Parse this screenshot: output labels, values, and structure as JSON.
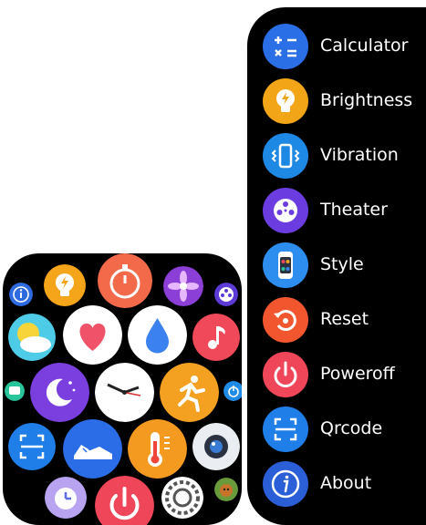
{
  "menu": {
    "items": [
      {
        "label": "Calculator",
        "icon": "calculator-icon",
        "color": "#2a6fe6"
      },
      {
        "label": "Brightness",
        "icon": "brightness-icon",
        "color": "#f2a516"
      },
      {
        "label": "Vibration",
        "icon": "vibration-icon",
        "color": "#1e88e5"
      },
      {
        "label": "Theater",
        "icon": "theater-icon",
        "color": "#6b3de0"
      },
      {
        "label": "Style",
        "icon": "style-icon",
        "color": "#2d8ef0"
      },
      {
        "label": "Reset",
        "icon": "reset-icon",
        "color": "#f2562e"
      },
      {
        "label": "Poweroff",
        "icon": "poweroff-icon",
        "color": "#f0465a"
      },
      {
        "label": "Qrcode",
        "icon": "qrcode-icon",
        "color": "#1f7ee8"
      },
      {
        "label": "About",
        "icon": "about-icon",
        "color": "#2a5fd8"
      }
    ]
  },
  "app_grid": {
    "apps": [
      "about-icon",
      "brightness-icon",
      "stopwatch-icon",
      "flower-icon",
      "theater-icon",
      "weather-icon",
      "heart-rate-icon",
      "water-drop-icon",
      "music-icon",
      "message-icon",
      "sleep-icon",
      "clock-icon",
      "workout-icon",
      "power-saving-icon",
      "qrcode-icon",
      "shoe-steps-icon",
      "temperature-icon",
      "camera-icon",
      "alarm-icon",
      "poweroff-icon",
      "settings-icon",
      "game-icon"
    ]
  }
}
